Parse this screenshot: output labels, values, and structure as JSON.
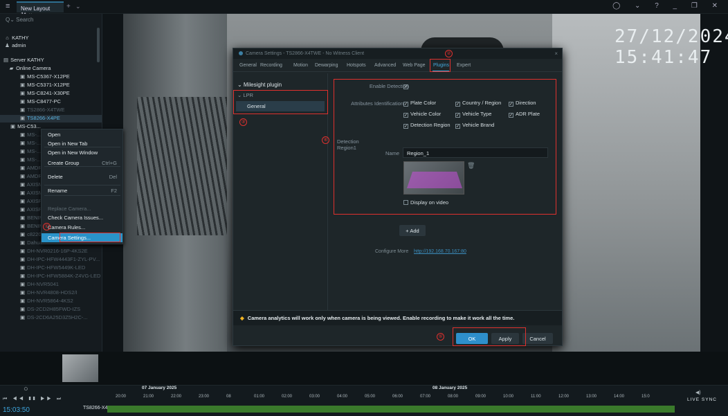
{
  "topbar": {
    "menu": "≡",
    "tab_title": "New Layout 1*",
    "tab_close": "×",
    "add": "+",
    "chev": "⌄",
    "controls": "◯ ⌄  ?  _  ❐  ✕"
  },
  "sidebar": {
    "search": "Q⌄ Search",
    "user1": "KATHY",
    "user2": "admin",
    "server": "Server KATHY",
    "online": "Online Camera",
    "cams": [
      "MS-C5367-X12PE",
      "MS-C5371-X12PE",
      "MS-C8241-X30PE",
      "MS-C8477-PC",
      "TS2866-X4TWE",
      "TS8266-X4PE",
      "MS-C53..."
    ],
    "dim": [
      "AMDRA...",
      "AMDRA...",
      "AXISM...",
      "AXISM...",
      "AXISP...",
      "AXISP...",
      "BENIMARDDV2018DV2",
      "BENIMARDDV32100",
      "c822025432d21P_Camera",
      "DahuaN43BU82",
      "DH-NVR0216-16P-4KS2E",
      "DH-IPC-HFW4443F1-ZYL-PV...",
      "DH-IPC-HFW5449K-LED",
      "DH-IPC-HFW5884K-Z4VG-LED",
      "DH-NVR5041",
      "DH-NVR4808-HDS2/I",
      "DH-NVR5864-4KS2",
      "DS-2CD2H85FWD-IZS",
      "DS-2CD6A25D3Z5H2C-..."
    ],
    "subs": [
      "MS-...",
      "MS-...",
      "MS-...",
      "MS-..."
    ]
  },
  "context_menu": {
    "items": [
      {
        "label": "Open",
        "shortcut": ""
      },
      {
        "label": "Open in New Tab",
        "shortcut": ""
      },
      {
        "label": "Open in New Window",
        "shortcut": ""
      },
      {
        "label": "Create Group",
        "shortcut": "Ctrl+G"
      },
      {
        "label": "Delete",
        "shortcut": "Del"
      },
      {
        "label": "Rename",
        "shortcut": "F2"
      },
      {
        "label": "Replace Camera...",
        "shortcut": ""
      },
      {
        "label": "Check Camera Issues...",
        "shortcut": ""
      },
      {
        "label": "Camera Rules...",
        "shortcut": ""
      },
      {
        "label": "Camera Settings...",
        "shortcut": ""
      }
    ]
  },
  "annotations": [
    "①",
    "②",
    "③",
    "④",
    "⑤"
  ],
  "video": {
    "osd": "27/12/2024 15:41:47"
  },
  "dialog": {
    "title": "Camera Settings - TS2866-X4TWE - No Witness Client",
    "close": "×",
    "tabs": [
      "General",
      "Recording",
      "Motion",
      "Dewarping",
      "Hotspots",
      "Advanced",
      "Web Page",
      "Plugins",
      "Expert"
    ],
    "plugin_group": "⌄ Milesight plugin",
    "plugin_lpr": "⌄ LPR",
    "plugin_general": "General",
    "enable_label": "Enable Detection",
    "attr_label": "Attributes Identification",
    "attrs": [
      "Plate Color",
      "Country / Region",
      "Direction",
      "Vehicle Color",
      "Vehicle Type",
      "ADR Plate",
      "Detection Region",
      "Vehicle Brand"
    ],
    "region_label": "Detection Region1",
    "name_label": "Name",
    "name_value": "Region_1",
    "display_video": "Display on video",
    "add": "+ Add",
    "configure_label": "Configure More",
    "configure_link": "http://192.168.70.167:80",
    "warning": "Camera analytics will work only when camera is being viewed. Enable recording to make it work all the time.",
    "ok": "OK",
    "apply": "Apply",
    "cancel": "Cancel"
  },
  "timeline": {
    "day1": "07 January 2025",
    "day2": "08 January 2025",
    "hours": [
      "20:00",
      "21:00",
      "22:00",
      "23:00",
      "08",
      "01:00",
      "02:00",
      "03:00",
      "04:00",
      "05:00",
      "06:00",
      "07:00",
      "08:00",
      "09:00",
      "10:00",
      "11:00",
      "12:00",
      "13:00",
      "14:00",
      "15:0"
    ],
    "clock": "15:03:50",
    "controls": "⏮ ◀◀ ❚❚ ▶▶ ⏭",
    "camera": "TS8266-X4PE",
    "live": "LIVE  SYNC"
  }
}
